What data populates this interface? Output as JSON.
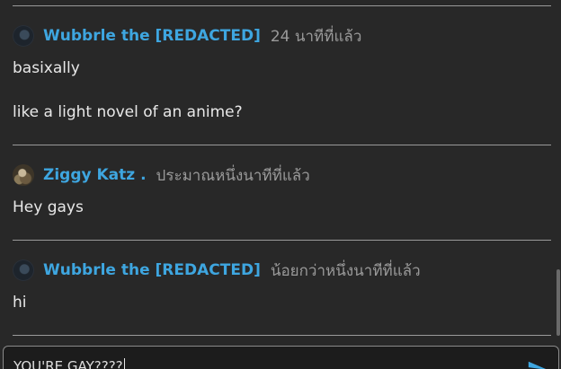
{
  "messages": [
    {
      "username": "Wubbrle the [REDACTED]",
      "timestamp": "24 นาทีที่แล้ว",
      "avatar": "dark-avatar",
      "lines": [
        "basixally",
        "like a light novel of an anime?"
      ]
    },
    {
      "username": "Ziggy Katz .",
      "timestamp": "ประมาณหนึ่งนาทีที่แล้ว",
      "avatar": "photo-avatar",
      "lines": [
        "Hey gays"
      ]
    },
    {
      "username": "Wubbrle the [REDACTED]",
      "timestamp": "น้อยกว่าหนึ่งนาทีที่แล้ว",
      "avatar": "dark-avatar",
      "lines": [
        "hi"
      ]
    }
  ],
  "composer": {
    "value": "YOU'RE GAY????",
    "send_icon": "send-icon"
  },
  "colors": {
    "background": "#282828",
    "username": "#3ea6e0",
    "timestamp": "#9a9a9a",
    "text": "#e8e8e8",
    "divider": "#9a9a9a"
  }
}
